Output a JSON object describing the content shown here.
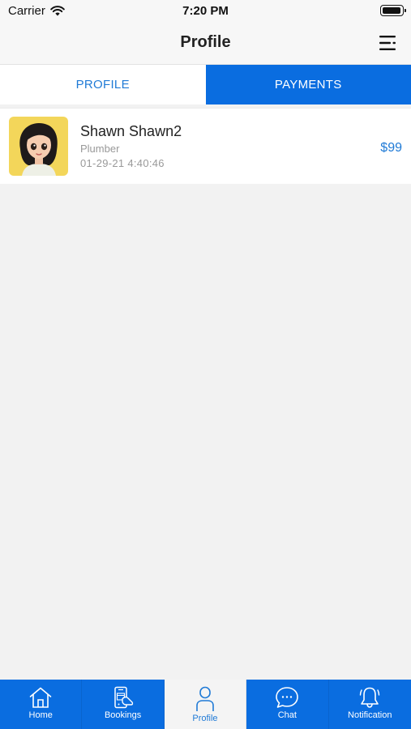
{
  "status_bar": {
    "carrier": "Carrier",
    "time": "7:20 PM"
  },
  "nav": {
    "title": "Profile",
    "menu_icon": "menu-icon"
  },
  "tabs": [
    {
      "label": "PROFILE",
      "selected": false
    },
    {
      "label": "PAYMENTS",
      "selected": true
    }
  ],
  "payments": [
    {
      "name": "Shawn Shawn2",
      "profession": "Plumber",
      "date": "01-29-21 4:40:46",
      "amount": "$99"
    }
  ],
  "bottom_tabs": [
    {
      "label": "Home",
      "icon": "home-icon",
      "active": false
    },
    {
      "label": "Bookings",
      "icon": "bookings-icon",
      "active": false
    },
    {
      "label": "Profile",
      "icon": "profile-icon",
      "active": true
    },
    {
      "label": "Chat",
      "icon": "chat-icon",
      "active": false
    },
    {
      "label": "Notification",
      "icon": "bell-icon",
      "active": false
    }
  ],
  "colors": {
    "accent": "#0a6de0",
    "link_blue": "#1f7ad6",
    "background": "#f2f2f2",
    "avatar_bg": "#f3d65a"
  }
}
